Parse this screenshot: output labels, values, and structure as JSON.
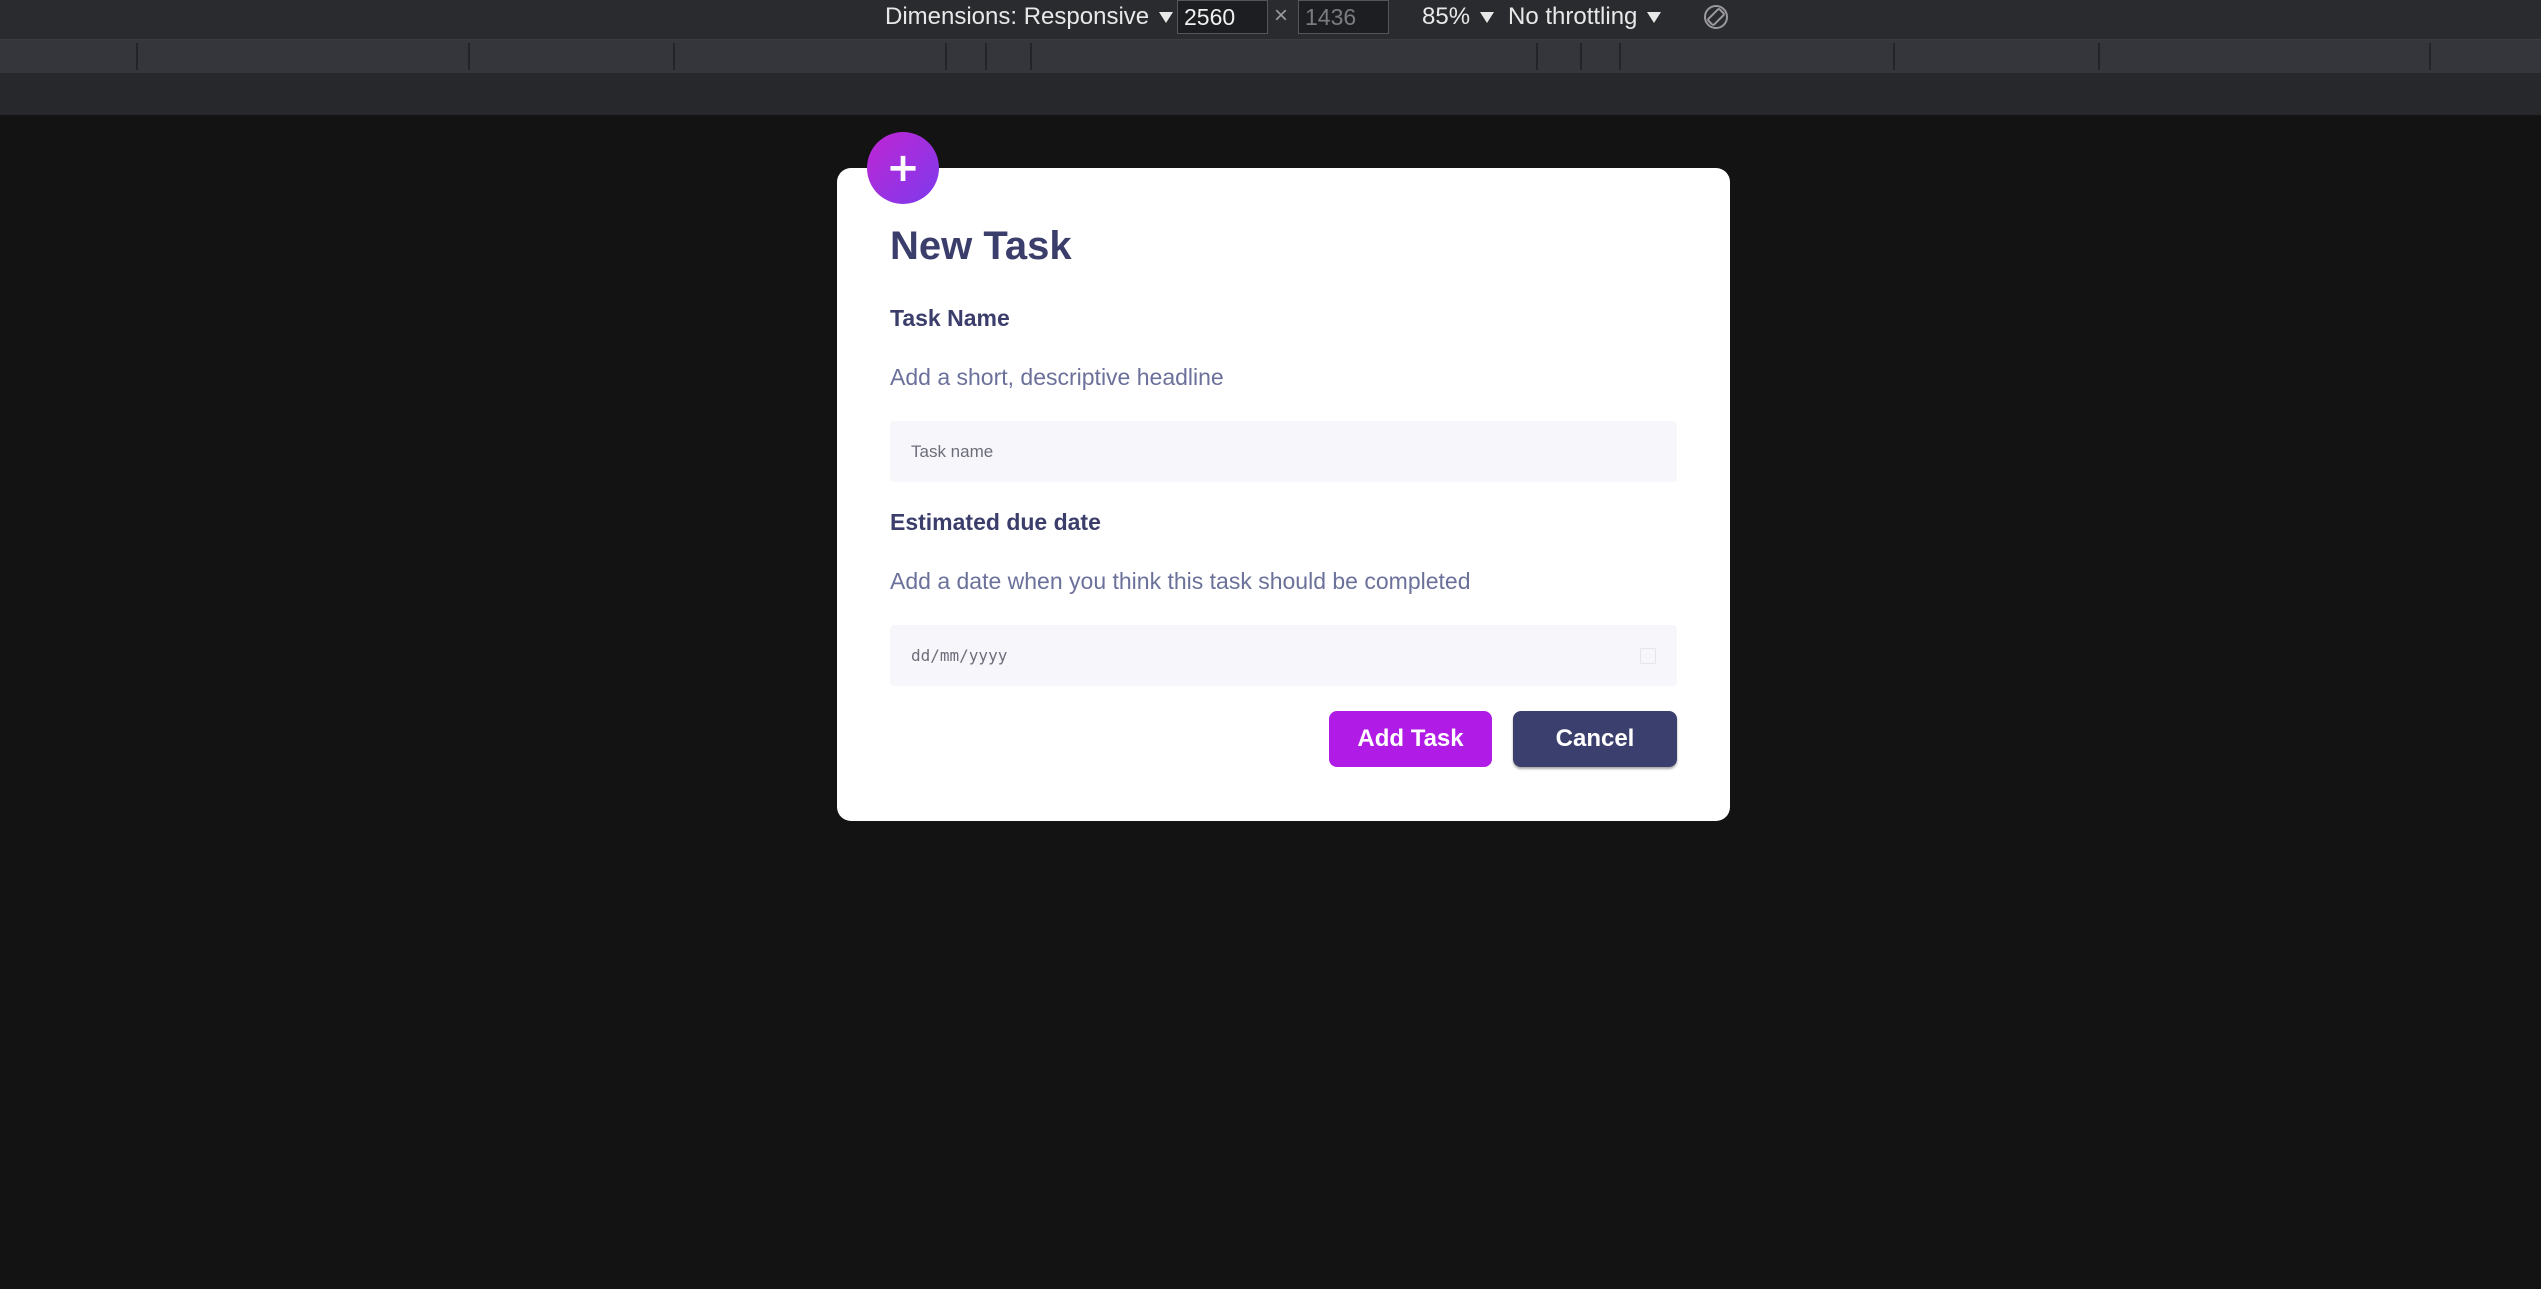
{
  "devtools": {
    "dimensions_label": "Dimensions: Responsive",
    "width_value": "2560",
    "height_placeholder": "1436",
    "times": "×",
    "zoom": "85%",
    "throttling": "No throttling",
    "rotate_icon": "rotate-device-icon"
  },
  "modal": {
    "add_icon": "+",
    "title": "New Task",
    "task_name": {
      "label": "Task Name",
      "help": "Add a short, descriptive headline",
      "placeholder": "Task name"
    },
    "due_date": {
      "label": "Estimated due date",
      "help": "Add a date when you think this task should be completed",
      "placeholder": "dd/mm/yyyy"
    },
    "add_button": "Add Task",
    "cancel_button": "Cancel"
  },
  "colors": {
    "page_background": "#131313",
    "modal_background": "#ffffff",
    "title_text": "#3b3d6b",
    "help_text": "#6b719a",
    "add_button": "#b01be6",
    "cancel_button": "#3b3f6d",
    "icon_gradient_start": "#c026d3",
    "icon_gradient_end": "#7c3aed"
  }
}
